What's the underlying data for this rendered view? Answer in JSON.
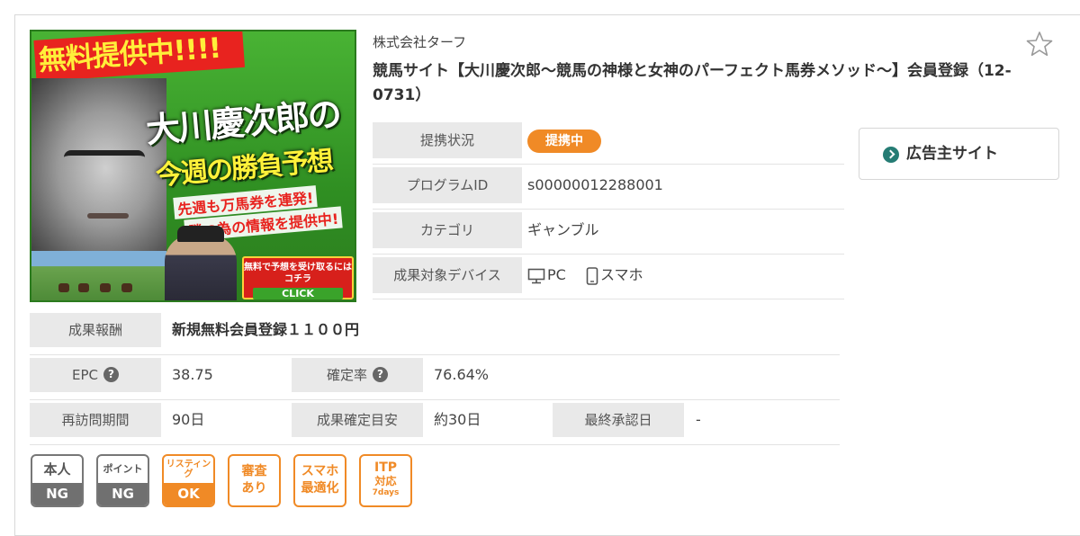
{
  "banner": {
    "top_tag": "無料提供中!!!!",
    "headline1": "大川慶次郎の",
    "headline2": "今週の勝負予想",
    "sub1": "先週も万馬券を連発!",
    "sub2": "勝つ為の情報を提供中!",
    "cta": "無料で予想を受け取るには コチラ",
    "cta_click": "CLICK"
  },
  "company": "株式会社ターフ",
  "title": "競馬サイト【大川慶次郎～競馬の神様と女神のパーフェクト馬券メソッド～】会員登録（12-0731）",
  "favorite_icon": "star-outline-icon",
  "info": {
    "status_label": "提携状況",
    "status_value": "提携中",
    "program_id_label": "プログラムID",
    "program_id_value": "s00000012288001",
    "category_label": "カテゴリ",
    "category_value": "ギャンブル",
    "device_label": "成果対象デバイス",
    "device_pc": "PC",
    "device_sp": "スマホ"
  },
  "advertiser_button": "広告主サイト",
  "reward": {
    "label": "成果報酬",
    "value": "新規無料会員登録１１００円"
  },
  "epc": {
    "label": "EPC",
    "value": "38.75"
  },
  "confirm_rate": {
    "label": "確定率",
    "value": "76.64%"
  },
  "revisit": {
    "label": "再訪問期間",
    "value": "90日"
  },
  "confirm_period": {
    "label": "成果確定目安",
    "value": "約30日"
  },
  "last_approval": {
    "label": "最終承認日",
    "value": "-"
  },
  "help_glyph": "?",
  "tags": {
    "self": {
      "top": "本人",
      "bottom": "NG"
    },
    "point": {
      "top": "ポイント",
      "bottom": "NG"
    },
    "listing": {
      "top": "リスティング",
      "bottom": "OK"
    },
    "review": {
      "line1": "審査",
      "line2": "あり"
    },
    "smartphone": {
      "line1": "スマホ",
      "line2": "最適化"
    },
    "itp": {
      "line1": "ITP",
      "line2": "対応",
      "line3": "7days"
    }
  },
  "colors": {
    "accent_orange": "#f08a26",
    "label_bg": "#e9e9e9",
    "teal": "#257c74",
    "gray_tag": "#707070"
  }
}
